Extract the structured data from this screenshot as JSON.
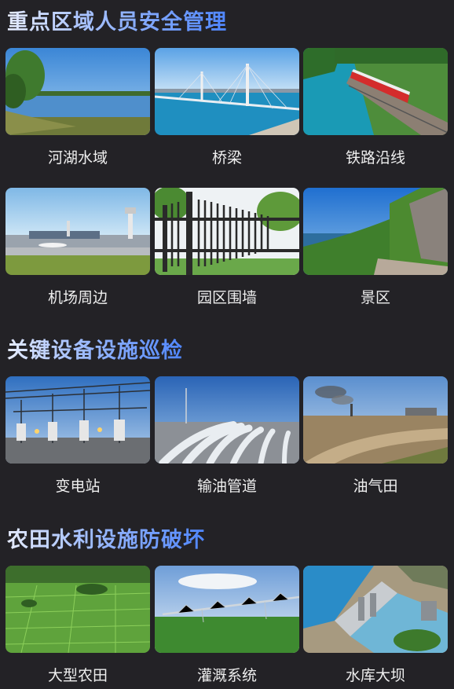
{
  "sections": [
    {
      "title": "重点区域人员安全管理",
      "items": [
        {
          "label": "河湖水域",
          "image": "lake-shore-image"
        },
        {
          "label": "桥梁",
          "image": "cable-bridge-image"
        },
        {
          "label": "铁路沿线",
          "image": "railway-train-image"
        },
        {
          "label": "机场周边",
          "image": "airport-image"
        },
        {
          "label": "园区围墙",
          "image": "iron-fence-image"
        },
        {
          "label": "景区",
          "image": "coastal-cliff-image"
        }
      ]
    },
    {
      "title": "关键设备设施巡检",
      "items": [
        {
          "label": "变电站",
          "image": "substation-image"
        },
        {
          "label": "输油管道",
          "image": "oil-pipeline-image"
        },
        {
          "label": "油气田",
          "image": "oilfield-image"
        }
      ]
    },
    {
      "title": "农田水利设施防破坏",
      "items": [
        {
          "label": "大型农田",
          "image": "farmland-image"
        },
        {
          "label": "灌溉系统",
          "image": "irrigation-image"
        },
        {
          "label": "水库大坝",
          "image": "reservoir-dam-image"
        }
      ]
    }
  ],
  "colors": {
    "background": "#232226",
    "title_gradient_start": "#e6ecff",
    "title_gradient_end": "#4f86ff",
    "caption_text": "#eeeeee"
  }
}
